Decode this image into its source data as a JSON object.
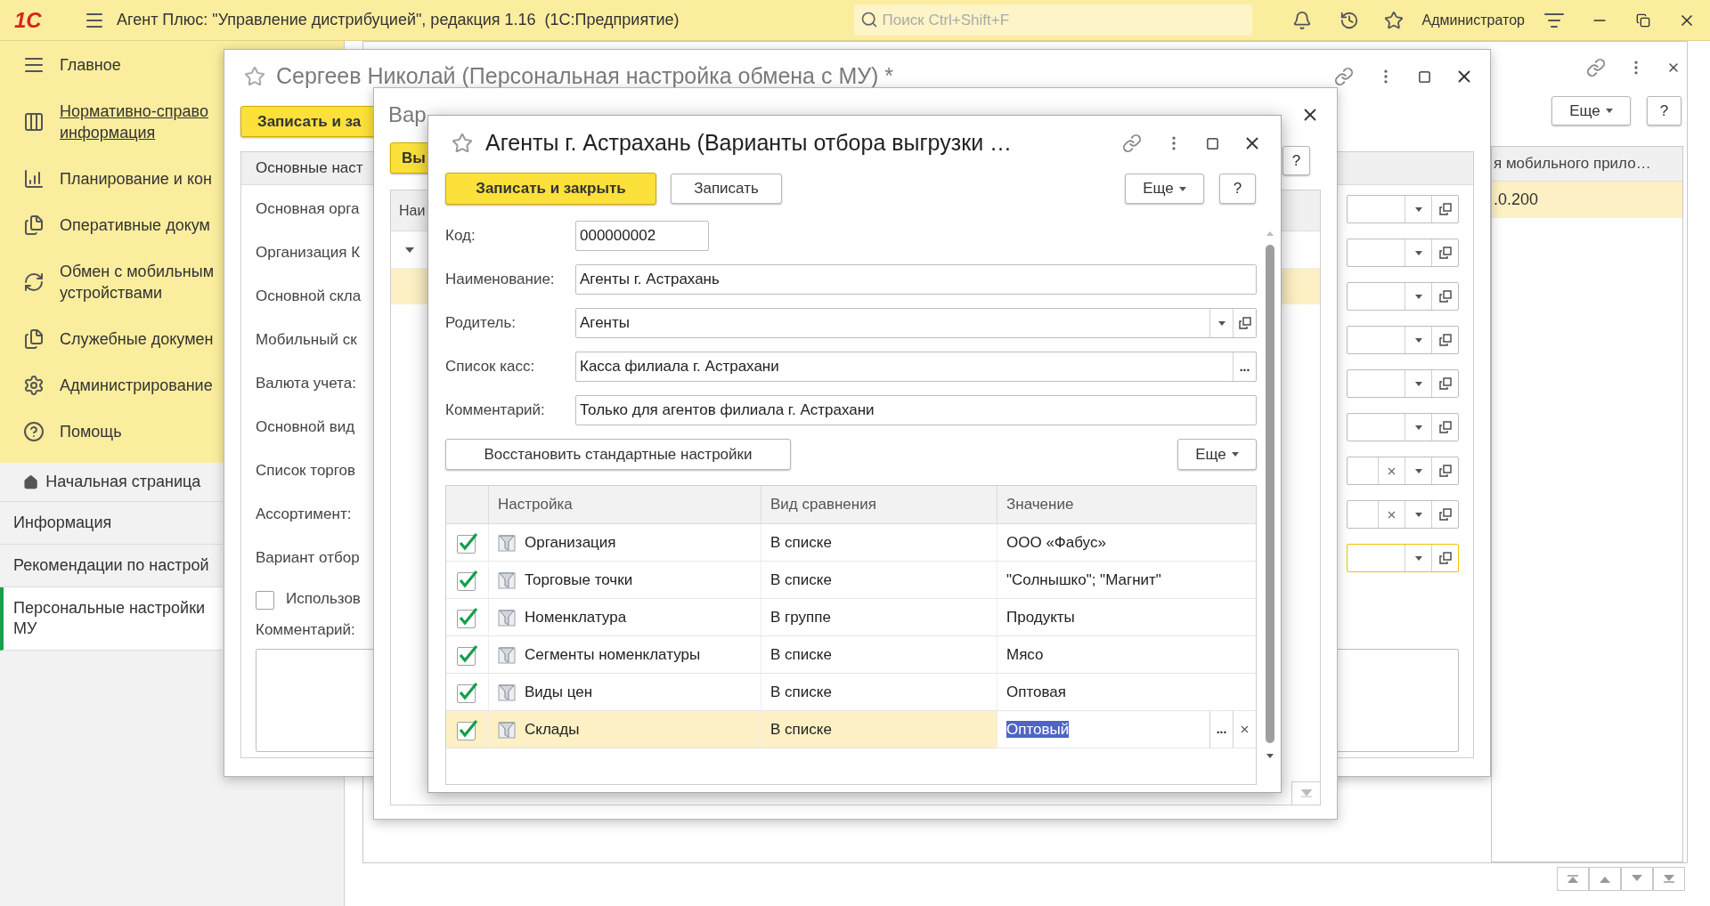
{
  "top_bar": {
    "logo": "1С",
    "title": "Агент Плюс: \"Управление дистрибуцией\", редакция 1.16  (1С:Предприятие)",
    "search": {
      "placeholder": "Поиск Ctrl+Shift+F"
    },
    "user": "Администратор"
  },
  "sidebar": {
    "sections": [
      {
        "label": "Главное",
        "hovered": false
      },
      {
        "label": "Нормативно-справо информация",
        "hovered": true
      },
      {
        "label": "Планирование и кон",
        "hovered": false
      },
      {
        "label": "Оперативные докум",
        "hovered": false
      },
      {
        "label": "Обмен с мобильным устройствами",
        "hovered": false
      },
      {
        "label": "Служебные докумен",
        "hovered": false
      },
      {
        "label": "Администрирование",
        "hovered": false
      },
      {
        "label": "Помощь",
        "hovered": false
      }
    ],
    "pages": [
      {
        "label": "Начальная страница",
        "selected": false
      },
      {
        "label": "Информация",
        "selected": false
      },
      {
        "label": "Рекомендации по настрой",
        "selected": false
      },
      {
        "label": "Персональные настройки МУ",
        "selected": true
      }
    ]
  },
  "main_panel": {
    "more_button": "Еще",
    "help_button": "?",
    "column_header": "я мобильного прило…",
    "cell": ".0.200"
  },
  "window_settings": {
    "title": "Сергеев Николай (Персональная настройка обмена с МУ) *",
    "save_button": "Записать и за",
    "tab": "Основные наст",
    "fields": [
      {
        "label": "Основная орга",
        "clear_button": false,
        "focused": false
      },
      {
        "label": "Организация К",
        "clear_button": false,
        "focused": false
      },
      {
        "label": "Основной скла",
        "clear_button": false,
        "focused": false
      },
      {
        "label": "Мобильный ск",
        "clear_button": false,
        "focused": false
      },
      {
        "label": "Валюта учета:",
        "clear_button": false,
        "focused": false
      },
      {
        "label": "Основной вид",
        "clear_button": false,
        "focused": false
      },
      {
        "label": "Список торгов",
        "clear_button": true,
        "focused": false
      },
      {
        "label": "Ассортимент:",
        "clear_button": true,
        "focused": false
      },
      {
        "label": "Вариант отбор",
        "clear_button": false,
        "focused": true
      }
    ],
    "checkbox": {
      "label": "Использов",
      "checked": false
    },
    "comment_label": "Комментарий:"
  },
  "window_variants": {
    "title": "Вар",
    "select_button": "Вы",
    "help_button": "?",
    "column_header": "Наи"
  },
  "dialog": {
    "title": "Агенты г. Астрахань (Варианты отбора выгрузки …",
    "save_close_button": "Записать и закрыть",
    "save_button": "Записать",
    "more_button": "Еще",
    "help_button": "?",
    "fields": [
      {
        "kind": "code",
        "label": "Код:",
        "value": "000000002"
      },
      {
        "kind": "text",
        "label": "Наименование:",
        "value": "Агенты г. Астрахань"
      },
      {
        "kind": "reference",
        "label": "Родитель:",
        "value": "Агенты"
      },
      {
        "kind": "choice",
        "label": "Список касс:",
        "value": "Касса филиала г. Астрахани",
        "button": "..."
      },
      {
        "kind": "text",
        "label": "Комментарий:",
        "value": "Только для агентов филиала г. Астрахани"
      }
    ],
    "restore_button": "Восстановить стандартные настройки",
    "table_more_button": "Еще",
    "table": {
      "columns": [
        "Настройка",
        "Вид сравнения",
        "Значение"
      ],
      "select_button": "...",
      "rows": [
        {
          "checked": true,
          "setting": "Организация",
          "comparison": "В списке",
          "value": "ООО «Фабус»",
          "selected": false
        },
        {
          "checked": true,
          "setting": "Торговые точки",
          "comparison": "В списке",
          "value": "\"Солнышко\"; \"Магнит\"",
          "selected": false
        },
        {
          "checked": true,
          "setting": "Номенклатура",
          "comparison": "В группе",
          "value": "Продукты",
          "selected": false
        },
        {
          "checked": true,
          "setting": "Сегменты номенклатуры",
          "comparison": "В списке",
          "value": "Мясо",
          "selected": false
        },
        {
          "checked": true,
          "setting": "Виды цен",
          "comparison": "В списке",
          "value": "Оптовая",
          "selected": false
        },
        {
          "checked": true,
          "setting": "Склады",
          "comparison": "В списке",
          "value": "Оптовый",
          "selected": true
        }
      ]
    }
  }
}
